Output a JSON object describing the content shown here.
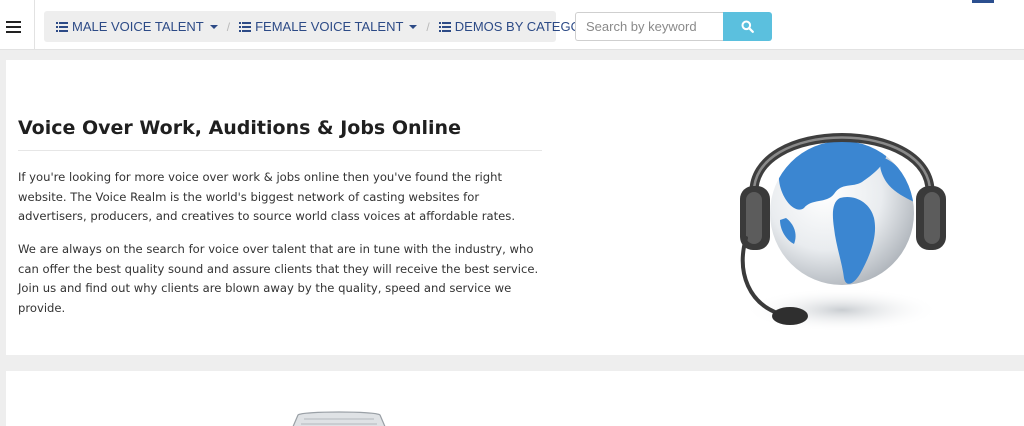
{
  "nav": {
    "items": [
      {
        "label": "MALE VOICE TALENT"
      },
      {
        "label": "FEMALE VOICE TALENT"
      },
      {
        "label": "DEMOS BY CATEGORY"
      }
    ],
    "separator": "/"
  },
  "search": {
    "placeholder": "Search by keyword",
    "value": ""
  },
  "hero": {
    "title": "Voice Over Work, Auditions & Jobs Online",
    "paragraphs": [
      "If you're looking for more voice over work & jobs online then you've found the right website. The Voice Realm is the world's biggest network of casting websites for advertisers, producers, and creatives to source world class voices at affordable rates.",
      "We are always on the search for voice over talent that are in tune with the industry, who can offer the best quality sound and assure clients that they will receive the best service. Join us and find out why clients are blown away by the quality, speed and service we provide."
    ]
  },
  "colors": {
    "nav_text": "#2c4a86",
    "search_button": "#5bc0de",
    "page_background": "#eeeeee"
  },
  "icons": {
    "menu": "hamburger-icon",
    "nav": "list-icon",
    "dropdown": "caret-down-icon",
    "search": "search-icon",
    "hero_image": "headset-globe-icon"
  }
}
